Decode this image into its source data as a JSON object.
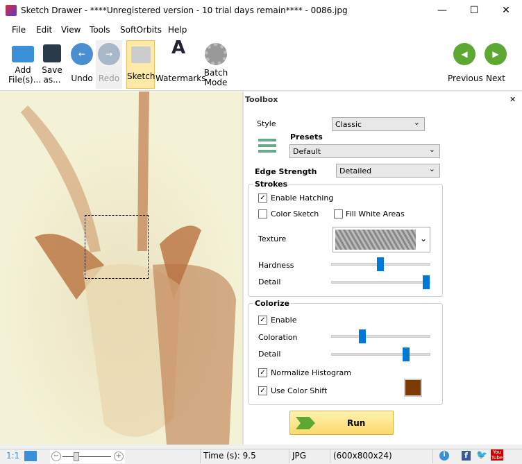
{
  "window": {
    "title": "Sketch Drawer - ****Unregistered version - 10 trial days remain**** - 0086.jpg",
    "minimize": "—",
    "maximize": "☐",
    "close": "✕"
  },
  "menu": [
    "File",
    "Edit",
    "View",
    "Tools",
    "SoftOrbits",
    "Help"
  ],
  "toolbar": {
    "add": "Add File(s)...",
    "save": "Save as...",
    "undo": "Undo",
    "redo": "Redo",
    "sketch": "Sketch",
    "watermarks": "Watermarks",
    "batch": "Batch Mode",
    "previous": "Previous",
    "next": "Next"
  },
  "toolbox": {
    "title": "Toolbox",
    "close": "✕",
    "style_label": "Style",
    "style_value": "Classic",
    "presets_label": "Presets",
    "presets_value": "Default",
    "edge_label": "Edge Strength",
    "edge_value": "Detailed",
    "strokes": {
      "title": "Strokes",
      "enable_hatching": "Enable Hatching",
      "enable_hatching_checked": true,
      "color_sketch": "Color Sketch",
      "color_sketch_checked": false,
      "fill_white": "Fill White Areas",
      "fill_white_checked": false,
      "texture_label": "Texture",
      "hardness_label": "Hardness",
      "hardness": 0.5,
      "detail_label": "Detail",
      "detail": 1.0
    },
    "colorize": {
      "title": "Colorize",
      "enable": "Enable",
      "enable_checked": true,
      "coloration_label": "Coloration",
      "coloration": 0.3,
      "detail_label": "Detail",
      "detail": 0.75,
      "normalize": "Normalize Histogram",
      "normalize_checked": true,
      "color_shift": "Use Color Shift",
      "color_shift_checked": true,
      "color": "#7a3a00"
    },
    "run": "Run"
  },
  "status": {
    "ratio": "1:1",
    "time": "Time (s): 9.5",
    "format": "JPG",
    "dims": "(600x800x24)",
    "youtube": "You Tube"
  }
}
